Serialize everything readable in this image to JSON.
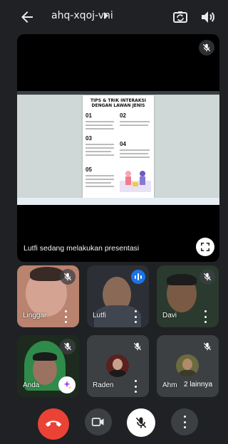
{
  "header": {
    "meeting_code": "ahq-xqoj-vni"
  },
  "presentation": {
    "caption": "Lutfi sedang melakukan presentasi",
    "slide": {
      "title": "TIPS & TRIK INTERAKSI DENGAN LAWAN JENIS",
      "numbers": [
        "01",
        "02",
        "03",
        "04",
        "05"
      ]
    }
  },
  "participants": [
    {
      "name": "Linggar",
      "muted": true
    },
    {
      "name": "Lutfi",
      "muted": false,
      "speaking": true
    },
    {
      "name": "Davi",
      "muted": true
    },
    {
      "name": "Anda",
      "muted": true
    },
    {
      "name": "Raden",
      "muted": true
    },
    {
      "name": "Ahm",
      "muted": true
    }
  ],
  "overflow": {
    "label": "2 lainnya"
  },
  "colors": {
    "end_call": "#ea4335",
    "speaking": "#1a73e8",
    "background": "#202124"
  },
  "icons": [
    "back-arrow-icon",
    "switch-camera-icon",
    "speaker-icon",
    "mic-off-icon",
    "fullscreen-icon",
    "more-vert-icon",
    "effects-icon",
    "end-call-icon",
    "camera-icon"
  ]
}
